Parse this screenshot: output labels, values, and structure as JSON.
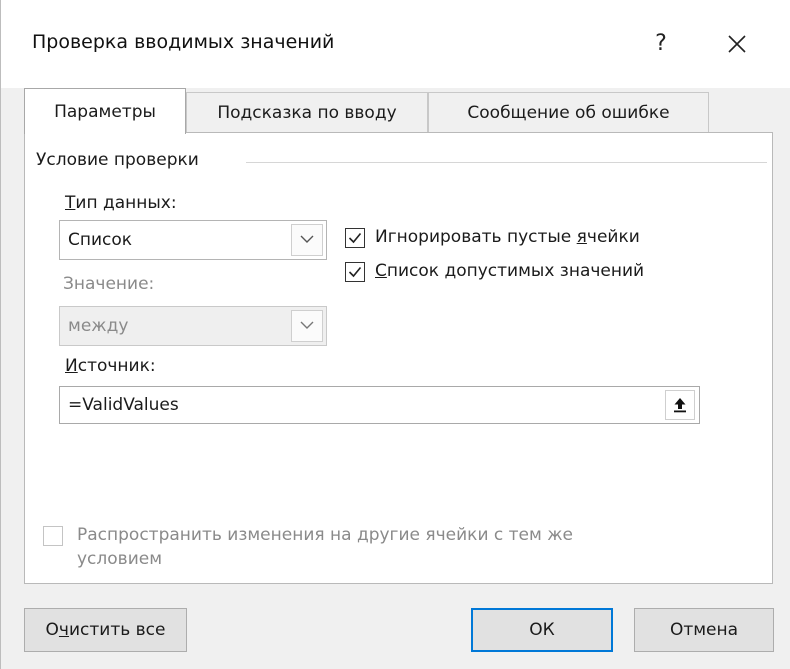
{
  "dialog": {
    "title": "Проверка вводимых значений",
    "help": "?"
  },
  "tabs": [
    {
      "label": "Параметры",
      "active": true
    },
    {
      "label": "Подсказка по вводу",
      "active": false
    },
    {
      "label": "Сообщение об ошибке",
      "active": false
    }
  ],
  "group": {
    "label": "Условие проверки"
  },
  "data_type": {
    "label_accel": "Т",
    "label_rest": "ип данных:",
    "value": "Список"
  },
  "operator": {
    "label": "Значение:",
    "value": "между",
    "disabled": true
  },
  "ignore_blank": {
    "label_pre": "Игнорировать пустые ",
    "label_accel": "я",
    "label_post": "чейки",
    "checked": true
  },
  "in_cell_dropdown": {
    "label_accel": "С",
    "label_rest": "писок допустимых значений",
    "checked": true
  },
  "source": {
    "label_accel": "И",
    "label_rest": "сточник:",
    "value": "=ValidValues"
  },
  "apply_all": {
    "line1": "Распространить изменения на другие ячейки с тем же",
    "line2": "условием",
    "checked": false,
    "disabled": true
  },
  "buttons": {
    "clear_pre": "О",
    "clear_accel": "ч",
    "clear_post": "истить все",
    "ok": "ОК",
    "cancel": "Отмена"
  },
  "colors": {
    "accent": "#0078d7",
    "panel_bg": "#ffffff",
    "dialog_bg": "#f0f0f0"
  },
  "icons": [
    "help-icon",
    "close-icon",
    "chevron-down-icon",
    "check-icon",
    "collapse-dialog-icon"
  ]
}
